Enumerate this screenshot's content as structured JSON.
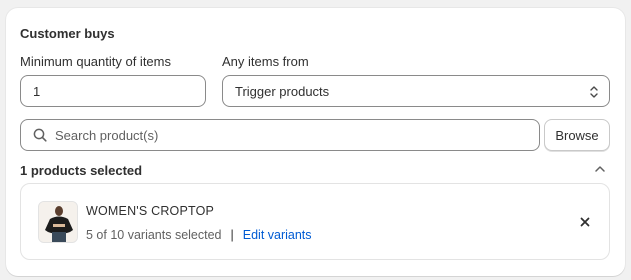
{
  "card": {
    "title": "Customer buys"
  },
  "quantity": {
    "label": "Minimum quantity of items",
    "value": "1"
  },
  "items_from": {
    "label": "Any items from",
    "selected": "Trigger products"
  },
  "search": {
    "placeholder": "Search product(s)",
    "icon": "search-icon"
  },
  "browse": {
    "label": "Browse"
  },
  "selection": {
    "count_text": "1 products selected",
    "icon": "chevron-up-icon"
  },
  "product": {
    "name": "WOMEN'S CROPTOP",
    "variants_text": "5 of 10 variants selected",
    "separator": "|",
    "edit_label": "Edit variants",
    "remove_icon": "close-icon"
  },
  "colors": {
    "link": "#005bd3",
    "text": "#303030",
    "muted": "#616161",
    "background": "#f1f1f1"
  }
}
